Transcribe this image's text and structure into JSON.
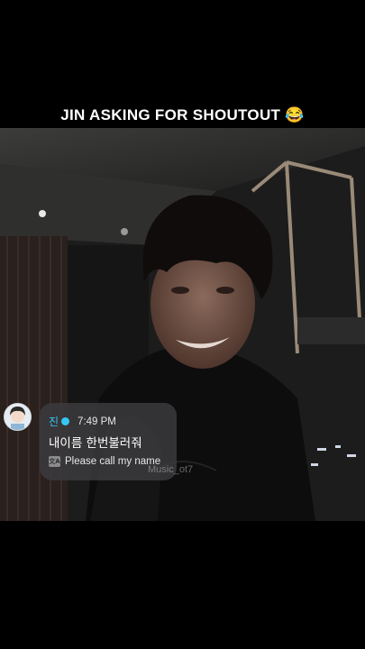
{
  "caption": {
    "text": "JIN ASKING FOR SHOUTOUT",
    "emoji": "😂"
  },
  "comment": {
    "avatar": "user-avatar",
    "username": "진",
    "verified_badge": "verified-badge-icon",
    "time": "7:49 PM",
    "message": "내이름 한번불러줘",
    "translate_icon": "translate-icon",
    "translation": "Please call my name"
  },
  "watermark": {
    "text": "Music_ot7"
  },
  "colors": {
    "background": "#000000",
    "username": "#35c7f5",
    "bubble": "#3a3a3c",
    "caption": "#ffffff"
  }
}
